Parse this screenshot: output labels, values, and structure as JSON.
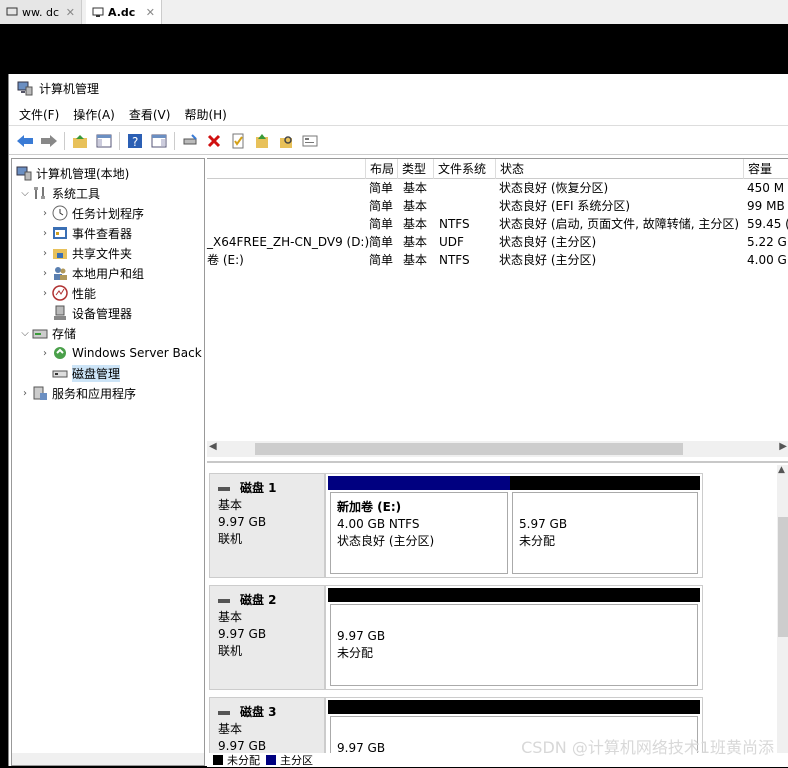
{
  "tabs": [
    {
      "label": "ww. dc",
      "close": "✕"
    },
    {
      "label": "A.dc",
      "close": "✕"
    }
  ],
  "window": {
    "title": "计算机管理"
  },
  "menu": [
    "文件(F)",
    "操作(A)",
    "查看(V)",
    "帮助(H)"
  ],
  "tree": {
    "root": "计算机管理(本地)",
    "system_tools": "系统工具",
    "task_scheduler": "任务计划程序",
    "event_viewer": "事件查看器",
    "shared_folders": "共享文件夹",
    "local_users": "本地用户和组",
    "performance": "性能",
    "device_manager": "设备管理器",
    "storage": "存储",
    "windows_backup": "Windows Server Back",
    "disk_management": "磁盘管理",
    "services_apps": "服务和应用程序"
  },
  "columns": {
    "layout": "布局",
    "type": "类型",
    "fs": "文件系统",
    "status": "状态",
    "capacity": "容量"
  },
  "volumes": [
    {
      "name": "",
      "layout": "简单",
      "type": "基本",
      "fs": "",
      "status": "状态良好 (恢复分区)",
      "capacity": "450 M"
    },
    {
      "name": "",
      "layout": "简单",
      "type": "基本",
      "fs": "",
      "status": "状态良好 (EFI 系统分区)",
      "capacity": "99 MB"
    },
    {
      "name": "",
      "layout": "简单",
      "type": "基本",
      "fs": "NTFS",
      "status": "状态良好 (启动, 页面文件, 故障转储, 主分区)",
      "capacity": "59.45 ("
    },
    {
      "name": "_X64FREE_ZH-CN_DV9 (D:)",
      "layout": "简单",
      "type": "基本",
      "fs": "UDF",
      "status": "状态良好 (主分区)",
      "capacity": "5.22 G"
    },
    {
      "name": "卷 (E:)",
      "layout": "简单",
      "type": "基本",
      "fs": "NTFS",
      "status": "状态良好 (主分区)",
      "capacity": "4.00 G"
    }
  ],
  "disks": [
    {
      "name": "磁盘 1",
      "kind": "基本",
      "size": "9.97 GB",
      "state": "联机",
      "parts": [
        {
          "title": "新加卷  (E:)",
          "line1": "4.00 GB NTFS",
          "line2": "状态良好 (主分区)"
        },
        {
          "title": "",
          "line1": "5.97 GB",
          "line2": "未分配"
        }
      ]
    },
    {
      "name": "磁盘 2",
      "kind": "基本",
      "size": "9.97 GB",
      "state": "联机",
      "parts": [
        {
          "title": "",
          "line1": "9.97 GB",
          "line2": "未分配"
        }
      ]
    },
    {
      "name": "磁盘 3",
      "kind": "基本",
      "size": "9.97 GB",
      "state": "",
      "parts": [
        {
          "title": "",
          "line1": "9.97 GB",
          "line2": ""
        }
      ]
    }
  ],
  "legend": {
    "unallocated": "未分配",
    "primary": "主分区"
  },
  "watermark": "CSDN @计算机网络技术1班黄尚添",
  "colors": {
    "primary_partition": "#000080",
    "unallocated": "#000000",
    "selection": "#cce4f7"
  }
}
